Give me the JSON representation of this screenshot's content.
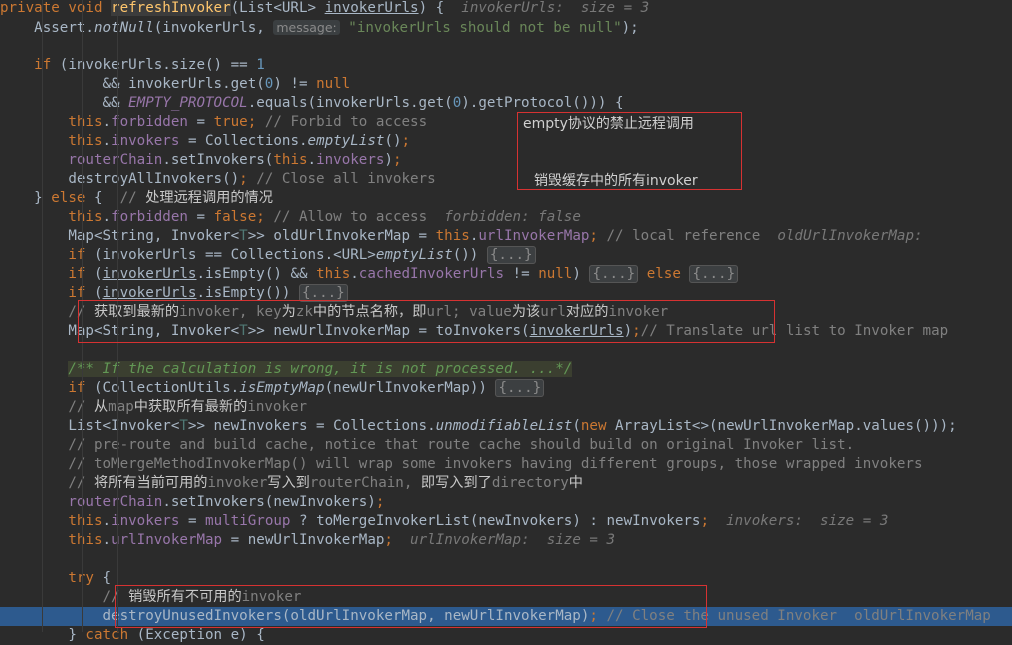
{
  "code_lines": [
    {
      "tokens": [
        {
          "c": "kw",
          "t": "private void "
        },
        {
          "c": "fnsel",
          "t": "refreshInvoker"
        },
        {
          "t": "(List<URL> "
        },
        {
          "c": "ul",
          "t": "invokerUrls"
        },
        {
          "t": ") {  "
        },
        {
          "c": "hint",
          "t": "invokerUrls:  size = 3"
        }
      ]
    },
    {
      "tokens": [
        {
          "t": "    Assert."
        },
        {
          "c": "ital",
          "t": "notNull"
        },
        {
          "t": "(invokerUrls, "
        },
        {
          "c": "pname",
          "t": "message:"
        },
        {
          "c": "str",
          "t": " \"invokerUrls should not be null\""
        },
        {
          "t": ");"
        }
      ]
    },
    {
      "tokens": [
        {
          "t": ""
        }
      ]
    },
    {
      "tokens": [
        {
          "t": "    "
        },
        {
          "c": "kw",
          "t": "if "
        },
        {
          "t": "(invokerUrls.size() == "
        },
        {
          "c": "num",
          "t": "1"
        }
      ]
    },
    {
      "tokens": [
        {
          "t": "            && invokerUrls.get("
        },
        {
          "c": "num",
          "t": "0"
        },
        {
          "t": ") != "
        },
        {
          "c": "kw",
          "t": "null"
        }
      ]
    },
    {
      "tokens": [
        {
          "t": "            && "
        },
        {
          "c": "static",
          "t": "EMPTY_PROTOCOL"
        },
        {
          "t": ".equals(invokerUrls.get("
        },
        {
          "c": "num",
          "t": "0"
        },
        {
          "t": ").getProtocol())) {"
        }
      ]
    },
    {
      "tokens": [
        {
          "t": "        "
        },
        {
          "c": "kw",
          "t": "this"
        },
        {
          "t": "."
        },
        {
          "c": "fld",
          "t": "forbidden"
        },
        {
          "t": " = "
        },
        {
          "c": "kw",
          "t": "true"
        },
        {
          "c": "kw",
          "t": "; "
        },
        {
          "c": "cmt",
          "t": "// Forbid to access"
        }
      ]
    },
    {
      "tokens": [
        {
          "t": "        "
        },
        {
          "c": "kw",
          "t": "this"
        },
        {
          "t": "."
        },
        {
          "c": "fld",
          "t": "invokers"
        },
        {
          "t": " = Collections."
        },
        {
          "c": "ital",
          "t": "emptyList"
        },
        {
          "t": "()"
        },
        {
          "c": "kw",
          "t": ";"
        }
      ]
    },
    {
      "tokens": [
        {
          "t": "        "
        },
        {
          "c": "fld",
          "t": "routerChain"
        },
        {
          "t": ".setInvokers("
        },
        {
          "c": "kw",
          "t": "this"
        },
        {
          "t": "."
        },
        {
          "c": "fld",
          "t": "invokers"
        },
        {
          "t": ")"
        },
        {
          "c": "kw",
          "t": ";"
        }
      ]
    },
    {
      "tokens": [
        {
          "t": "        destroyAllInvokers()"
        },
        {
          "c": "kw",
          "t": "; "
        },
        {
          "c": "cmt",
          "t": "// Close all invokers"
        }
      ]
    },
    {
      "tokens": [
        {
          "t": "    } "
        },
        {
          "c": "kw",
          "t": "else "
        },
        {
          "t": "{  "
        },
        {
          "c": "cmt",
          "t": "// "
        },
        {
          "c": "cn",
          "t": "处理远程调用的情况"
        }
      ]
    },
    {
      "tokens": [
        {
          "t": "        "
        },
        {
          "c": "kw",
          "t": "this"
        },
        {
          "t": "."
        },
        {
          "c": "fld",
          "t": "forbidden"
        },
        {
          "t": " = "
        },
        {
          "c": "kw",
          "t": "false"
        },
        {
          "c": "kw",
          "t": "; "
        },
        {
          "c": "cmt",
          "t": "// Allow to access  "
        },
        {
          "c": "hint",
          "t": "forbidden: false"
        }
      ]
    },
    {
      "tokens": [
        {
          "t": "        Map<String, Invoker<"
        },
        {
          "c": "gen",
          "t": "T"
        },
        {
          "t": ">> oldUrlInvokerMap = "
        },
        {
          "c": "kw",
          "t": "this"
        },
        {
          "t": "."
        },
        {
          "c": "fld",
          "t": "urlInvokerMap"
        },
        {
          "c": "kw",
          "t": "; "
        },
        {
          "c": "cmt",
          "t": "// local reference  "
        },
        {
          "c": "hint",
          "t": "oldUrlInvokerMap:"
        }
      ]
    },
    {
      "tokens": [
        {
          "t": "        "
        },
        {
          "c": "kw",
          "t": "if "
        },
        {
          "t": "(invokerUrls == Collections.<URL>"
        },
        {
          "c": "ital",
          "t": "emptyList"
        },
        {
          "t": "()) "
        },
        {
          "c": "fold",
          "t": "{...}"
        }
      ]
    },
    {
      "tokens": [
        {
          "t": "        "
        },
        {
          "c": "kw",
          "t": "if "
        },
        {
          "t": "("
        },
        {
          "c": "ul",
          "t": "invokerUrls"
        },
        {
          "t": ".isEmpty() && "
        },
        {
          "c": "kw",
          "t": "this"
        },
        {
          "t": "."
        },
        {
          "c": "fld",
          "t": "cachedInvokerUrls"
        },
        {
          "t": " != "
        },
        {
          "c": "kw",
          "t": "null"
        },
        {
          "t": ") "
        },
        {
          "c": "fold",
          "t": "{...}"
        },
        {
          "t": " "
        },
        {
          "c": "kw",
          "t": "else "
        },
        {
          "c": "fold",
          "t": "{...}"
        }
      ]
    },
    {
      "tokens": [
        {
          "t": "        "
        },
        {
          "c": "kw",
          "t": "if "
        },
        {
          "t": "("
        },
        {
          "c": "ul",
          "t": "invokerUrls"
        },
        {
          "t": ".isEmpty()) "
        },
        {
          "c": "fold",
          "t": "{...}"
        }
      ]
    },
    {
      "tokens": [
        {
          "t": "        "
        },
        {
          "c": "cmt",
          "t": "// "
        },
        {
          "c": "cn",
          "t": "获取到最新的"
        },
        {
          "c": "cmt",
          "t": "invoker, key"
        },
        {
          "c": "cn",
          "t": "为"
        },
        {
          "c": "cmt",
          "t": "zk"
        },
        {
          "c": "cn",
          "t": "中的节点名称，即"
        },
        {
          "c": "cmt",
          "t": "url; value"
        },
        {
          "c": "cn",
          "t": "为该"
        },
        {
          "c": "cmt",
          "t": "url"
        },
        {
          "c": "cn",
          "t": "对应的"
        },
        {
          "c": "cmt",
          "t": "invoker"
        }
      ]
    },
    {
      "tokens": [
        {
          "t": "        Map<String, Invoker<"
        },
        {
          "c": "gen",
          "t": "T"
        },
        {
          "t": ">> newUrlInvokerMap = toInvokers("
        },
        {
          "c": "ul",
          "t": "invokerUrls"
        },
        {
          "t": ")"
        },
        {
          "c": "kw",
          "t": ";"
        },
        {
          "c": "cmt",
          "t": "// Translate url list to Invoker map"
        }
      ]
    },
    {
      "tokens": [
        {
          "t": ""
        }
      ]
    },
    {
      "tokens": [
        {
          "t": "        "
        },
        {
          "c": "doc",
          "t": "/** If the calculation is wrong, it is not processed. ...*/"
        }
      ]
    },
    {
      "tokens": [
        {
          "t": "        "
        },
        {
          "c": "kw",
          "t": "if "
        },
        {
          "t": "(CollectionUtils."
        },
        {
          "c": "ital",
          "t": "isEmptyMap"
        },
        {
          "t": "(newUrlInvokerMap)) "
        },
        {
          "c": "fold",
          "t": "{...}"
        }
      ]
    },
    {
      "tokens": [
        {
          "t": "        "
        },
        {
          "c": "cmt",
          "t": "// "
        },
        {
          "c": "cn",
          "t": "从"
        },
        {
          "c": "cmt",
          "t": "map"
        },
        {
          "c": "cn",
          "t": "中获取所有最新的"
        },
        {
          "c": "cmt",
          "t": "invoker"
        }
      ]
    },
    {
      "tokens": [
        {
          "t": "        List<Invoker<"
        },
        {
          "c": "gen",
          "t": "T"
        },
        {
          "t": ">> newInvokers = Collections."
        },
        {
          "c": "ital",
          "t": "unmodifiableList"
        },
        {
          "t": "("
        },
        {
          "c": "kw",
          "t": "new "
        },
        {
          "t": "ArrayList<>(newUrlInvokerMap.values()));"
        }
      ]
    },
    {
      "tokens": [
        {
          "t": "        "
        },
        {
          "c": "cmt",
          "t": "// pre-route and build cache, notice that route cache should build on original Invoker list."
        }
      ]
    },
    {
      "tokens": [
        {
          "t": "        "
        },
        {
          "c": "cmt",
          "t": "// toMergeMethodInvokerMap() will wrap some invokers having different groups, those wrapped invokers"
        }
      ]
    },
    {
      "tokens": [
        {
          "t": "        "
        },
        {
          "c": "cmt",
          "t": "// "
        },
        {
          "c": "cn",
          "t": "将所有当前可用的"
        },
        {
          "c": "cmt",
          "t": "invoker"
        },
        {
          "c": "cn",
          "t": "写入到"
        },
        {
          "c": "cmt",
          "t": "routerChain, "
        },
        {
          "c": "cn",
          "t": "即写入到了"
        },
        {
          "c": "cmt",
          "t": "directory"
        },
        {
          "c": "cn",
          "t": "中"
        }
      ]
    },
    {
      "tokens": [
        {
          "t": "        "
        },
        {
          "c": "fld",
          "t": "routerChain"
        },
        {
          "t": ".setInvokers(newInvokers)"
        },
        {
          "c": "kw",
          "t": ";"
        }
      ]
    },
    {
      "tokens": [
        {
          "t": "        "
        },
        {
          "c": "kw",
          "t": "this"
        },
        {
          "t": "."
        },
        {
          "c": "fld",
          "t": "invokers"
        },
        {
          "t": " = "
        },
        {
          "c": "fld",
          "t": "multiGroup"
        },
        {
          "t": " ? toMergeInvokerList(newInvokers) : newInvokers"
        },
        {
          "c": "kw",
          "t": ";  "
        },
        {
          "c": "hint",
          "t": "invokers:  size = 3"
        }
      ]
    },
    {
      "tokens": [
        {
          "t": "        "
        },
        {
          "c": "kw",
          "t": "this"
        },
        {
          "t": "."
        },
        {
          "c": "fld",
          "t": "urlInvokerMap"
        },
        {
          "t": " = newUrlInvokerMap"
        },
        {
          "c": "kw",
          "t": ";  "
        },
        {
          "c": "hint",
          "t": "urlInvokerMap:  size = 3"
        }
      ]
    },
    {
      "tokens": [
        {
          "t": ""
        }
      ]
    },
    {
      "tokens": [
        {
          "t": "        "
        },
        {
          "c": "kw",
          "t": "try "
        },
        {
          "t": "{"
        }
      ]
    },
    {
      "tokens": [
        {
          "t": "            "
        },
        {
          "c": "cmt",
          "t": "// "
        },
        {
          "c": "cn",
          "t": "销毁所有不可用的"
        },
        {
          "c": "cmt",
          "t": "invoker"
        }
      ]
    },
    {
      "tokens": [
        {
          "t": "            destroyUnusedInvokers(oldUrlInvokerMap, newUrlInvokerMap)"
        },
        {
          "c": "kw",
          "t": "; "
        },
        {
          "c": "cmt",
          "t": "// Close the unused Invoker  oldUrlInvokerMap"
        }
      ]
    },
    {
      "tokens": [
        {
          "t": "        } "
        },
        {
          "c": "kw",
          "t": "catch "
        },
        {
          "t": "(Exception e) {"
        }
      ]
    }
  ],
  "annotations": {
    "empty_protocol": "empty协议的禁止远程调用",
    "destroy_cached": "销毁缓存中的所有invoker"
  },
  "colors": {
    "background": "#2b2b2b",
    "keyword": "#cc7832",
    "field": "#9876aa",
    "comment": "#808080",
    "string": "#6a8759",
    "number": "#6897bb",
    "highlight_box": "#d63232",
    "execution_line": "#2d5a8e"
  }
}
